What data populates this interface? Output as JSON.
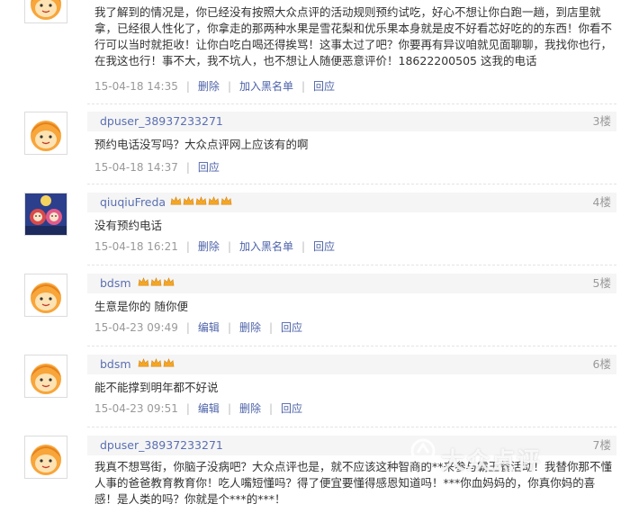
{
  "colors": {
    "username": "#5a6fb2",
    "action": "#4d63a8",
    "meta": "#999999",
    "star": "#f5a623"
  },
  "comments": [
    {
      "username": "",
      "stars": 0,
      "floor": "",
      "text": "我了解到的情况是，你已经没有按照大众点评的活动规则预约试吃，好心不想让你白跑一趟，到店里就拿，已经很人性化了，你拿走的那两种水果是雪花梨和优乐果本身就是皮不好看芯好吃的的东西！你看不行可以当时就拒收！让你白吃白喝还得挨骂！这事太过了吧？你要再有异议咱就见面聊聊，我找你也行，在我这也行！事不大，我不坑人，也不想让人随便恶意评价！18622200505 这我的电话",
      "time": "15-04-18 14:35",
      "actions": [
        "删除",
        "加入黑名单",
        "回应"
      ]
    },
    {
      "username": "dpuser_38937233271",
      "stars": 0,
      "floor": "3楼",
      "text": "预约电话没写吗？大众点评网上应该有的啊",
      "time": "15-04-18 14:37",
      "actions": [
        "回应"
      ]
    },
    {
      "username": "qiuqiuFreda",
      "stars": 5,
      "floor": "4楼",
      "text": "没有预约电话",
      "time": "15-04-18 16:21",
      "actions": [
        "删除",
        "加入黑名单",
        "回应"
      ]
    },
    {
      "username": "bdsm",
      "stars": 3,
      "floor": "5楼",
      "text": "生意是你的 随你便",
      "time": "15-04-23 09:49",
      "actions": [
        "编辑",
        "删除",
        "回应"
      ]
    },
    {
      "username": "bdsm",
      "stars": 3,
      "floor": "6楼",
      "text": "能不能撑到明年都不好说",
      "time": "15-04-23 09:51",
      "actions": [
        "编辑",
        "删除",
        "回应"
      ]
    },
    {
      "username": "dpuser_38937233271",
      "stars": 0,
      "floor": "7楼",
      "text": "我真不想骂街，你脑子没病吧？大众点评也是，就不应该这种智商的**来参与霸王餐活动！我替你那不懂人事的爸爸教育教育你！吃人嘴短懂吗？得了便宜要懂得感恩知道吗！***你血妈妈的，你真你妈的喜感！是人类的吗？你就是个***的***！",
      "time": "",
      "actions": []
    }
  ],
  "watermark": "大众点评"
}
